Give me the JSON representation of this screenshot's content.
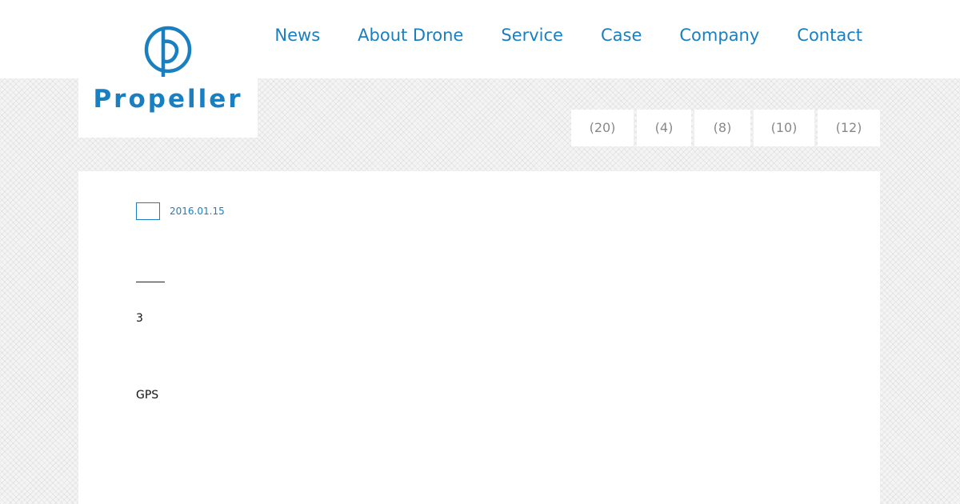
{
  "brand": {
    "name": "Propeller",
    "color": "#1a7fc1"
  },
  "nav": [
    {
      "label": "News"
    },
    {
      "label": "About Drone"
    },
    {
      "label": "Service"
    },
    {
      "label": "Case"
    },
    {
      "label": "Company"
    },
    {
      "label": "Contact"
    }
  ],
  "categories": [
    {
      "label": "(20)"
    },
    {
      "label": "(4)"
    },
    {
      "label": "(8)"
    },
    {
      "label": "(10)"
    },
    {
      "label": "(12)"
    }
  ],
  "post": {
    "date": "2016.01.15",
    "paragraphs": [
      "3",
      "GPS"
    ]
  }
}
